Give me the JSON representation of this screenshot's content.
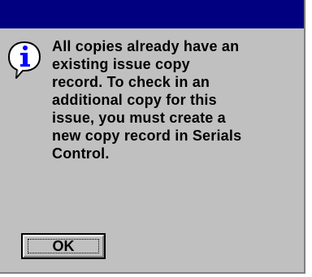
{
  "dialog": {
    "title": "",
    "icon": "information-icon",
    "message_lines": [
      "All copies already have an",
      "existing issue copy",
      "record.  To check in an",
      "additional copy for this",
      "issue, you must create a",
      "new copy record in Serials",
      "Control."
    ],
    "ok_label": "OK"
  },
  "colors": {
    "titlebar": "#000080",
    "face": "#c0c0c0",
    "icon_blue": "#0000ff"
  }
}
